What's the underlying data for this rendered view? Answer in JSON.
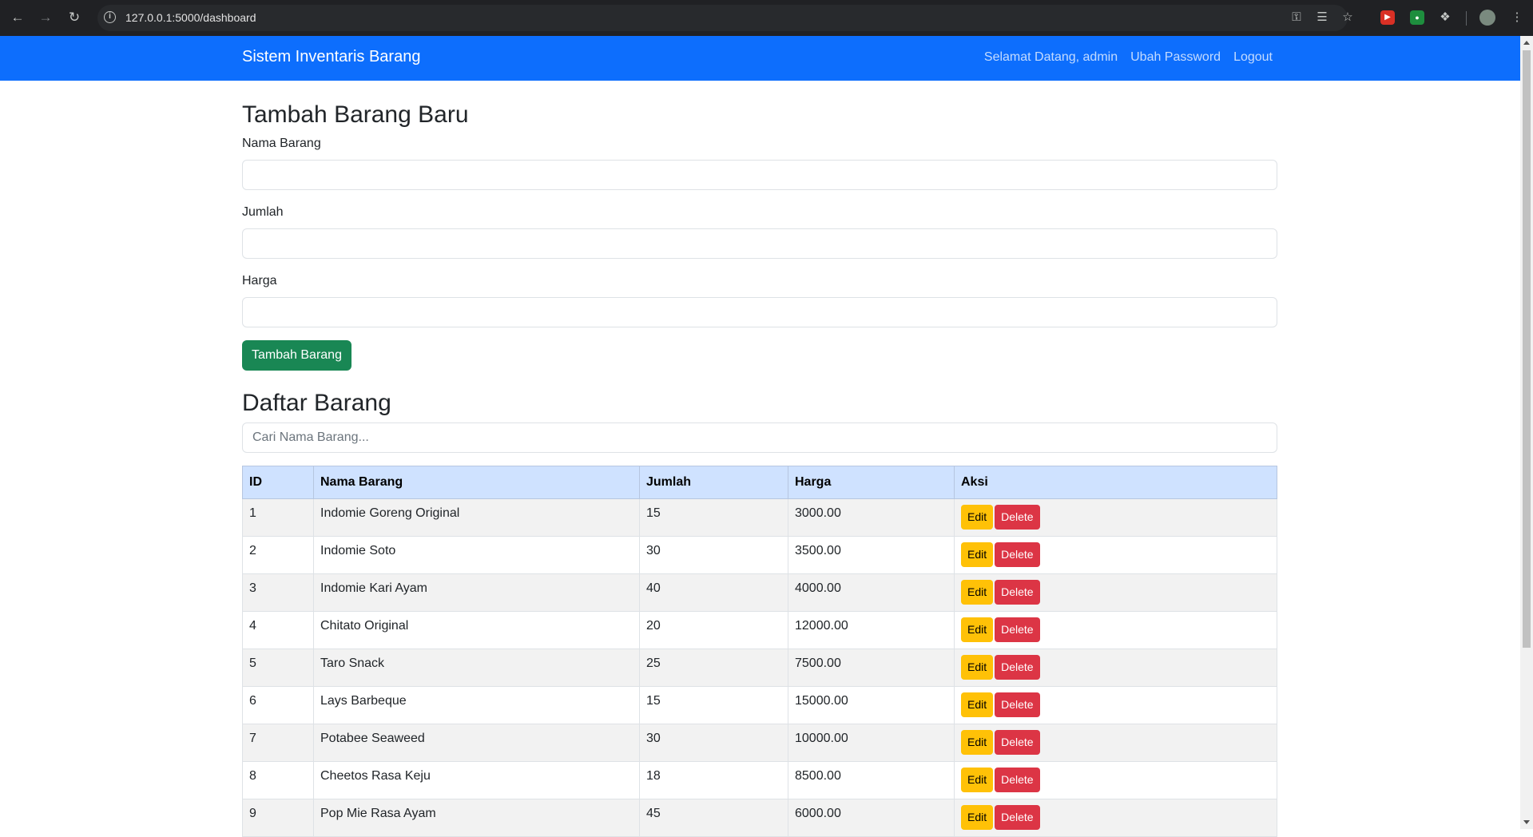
{
  "browser": {
    "url": "127.0.0.1:5000/dashboard"
  },
  "navbar": {
    "brand": "Sistem Inventaris Barang",
    "welcome": "Selamat Datang, admin",
    "change_password": "Ubah Password",
    "logout": "Logout"
  },
  "form": {
    "title": "Tambah Barang Baru",
    "name_label": "Nama Barang",
    "qty_label": "Jumlah",
    "price_label": "Harga",
    "name_value": "",
    "qty_value": "",
    "price_value": "",
    "submit_label": "Tambah Barang"
  },
  "list": {
    "title": "Daftar Barang",
    "search_placeholder": "Cari Nama Barang...",
    "columns": [
      "ID",
      "Nama Barang",
      "Jumlah",
      "Harga",
      "Aksi"
    ],
    "edit_label": "Edit",
    "delete_label": "Delete",
    "rows": [
      {
        "id": "1",
        "name": "Indomie Goreng Original",
        "qty": "15",
        "price": "3000.00"
      },
      {
        "id": "2",
        "name": "Indomie Soto",
        "qty": "30",
        "price": "3500.00"
      },
      {
        "id": "3",
        "name": "Indomie Kari Ayam",
        "qty": "40",
        "price": "4000.00"
      },
      {
        "id": "4",
        "name": "Chitato Original",
        "qty": "20",
        "price": "12000.00"
      },
      {
        "id": "5",
        "name": "Taro Snack",
        "qty": "25",
        "price": "7500.00"
      },
      {
        "id": "6",
        "name": "Lays Barbeque",
        "qty": "15",
        "price": "15000.00"
      },
      {
        "id": "7",
        "name": "Potabee Seaweed",
        "qty": "30",
        "price": "10000.00"
      },
      {
        "id": "8",
        "name": "Cheetos Rasa Keju",
        "qty": "18",
        "price": "8500.00"
      },
      {
        "id": "9",
        "name": "Pop Mie Rasa Ayam",
        "qty": "45",
        "price": "6000.00"
      }
    ]
  },
  "colors": {
    "navbar": "#0d6efd",
    "add_button": "#198754",
    "table_header": "#cfe2ff",
    "edit_button": "#ffc107",
    "delete_button": "#dc3545"
  }
}
